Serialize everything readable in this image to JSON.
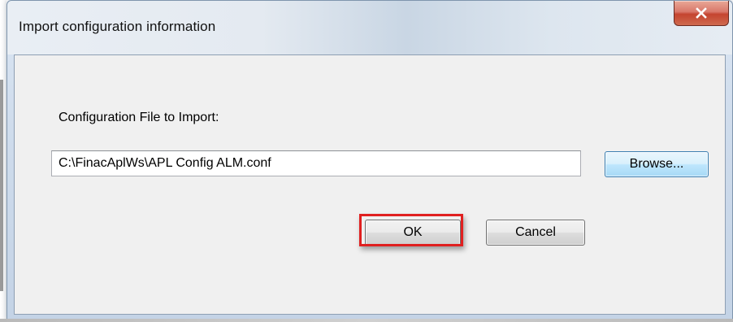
{
  "window": {
    "title": "Import configuration information",
    "close_icon": "close-icon"
  },
  "form": {
    "file_label": "Configuration File to Import:",
    "file_path_value": "C:\\FinacAplWs\\APL Config ALM.conf",
    "browse_label": "Browse...",
    "ok_label": "OK",
    "cancel_label": "Cancel"
  },
  "colors": {
    "highlight": "#e02020",
    "close_button": "#c4442f",
    "browse_focus": "#3c7fb1"
  }
}
